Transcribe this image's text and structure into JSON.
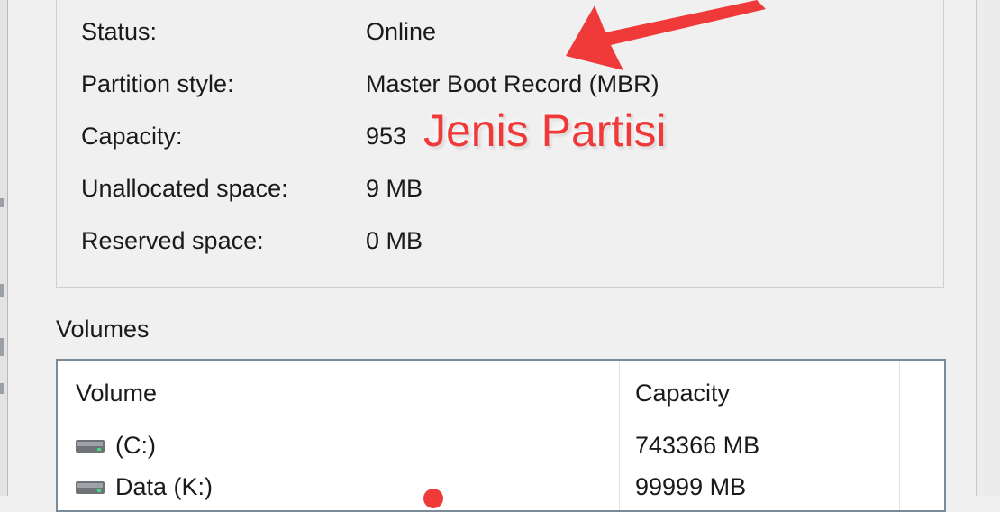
{
  "disk_info": {
    "rows": [
      {
        "label": "Status:",
        "value": "Online"
      },
      {
        "label": "Partition style:",
        "value": "Master Boot Record (MBR)"
      },
      {
        "label": "Capacity:",
        "value": "953"
      },
      {
        "label": "Unallocated space:",
        "value": "9 MB"
      },
      {
        "label": "Reserved space:",
        "value": "0 MB"
      }
    ]
  },
  "volumes": {
    "heading": "Volumes",
    "columns": [
      "Volume",
      "Capacity"
    ],
    "rows": [
      {
        "volume": "(C:)",
        "capacity": "743366 MB"
      },
      {
        "volume": "Data (K:)",
        "capacity": "99999 MB"
      }
    ]
  },
  "annotation": {
    "label": "Jenis Partisi",
    "color": "#f03a3a",
    "arrow_icon": "red-arrow-icon"
  }
}
